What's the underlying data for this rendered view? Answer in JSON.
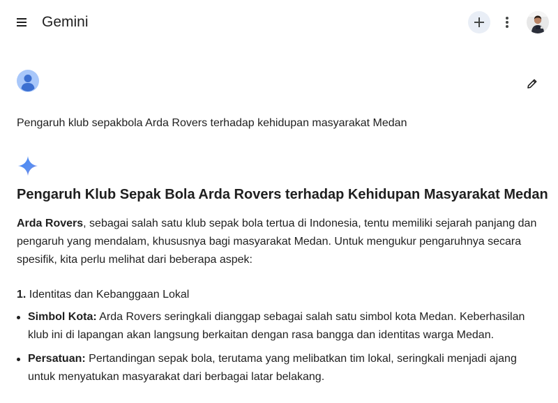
{
  "header": {
    "title": "Gemini",
    "menu_icon": "hamburger-menu-icon",
    "new_chat_icon": "plus-icon",
    "more_icon": "more-vert-icon"
  },
  "user_message": {
    "text": "Pengaruh klub sepakbola Arda Rovers terhadap kehidupan masyarakat Medan"
  },
  "response": {
    "heading": "Pengaruh Klub Sepak Bola Arda Rovers terhadap Kehidupan Masyarakat Medan",
    "intro_bold": "Arda Rovers",
    "intro_rest": ", sebagai salah satu klub sepak bola tertua di Indonesia, tentu memiliki sejarah panjang dan pengaruh yang mendalam, khususnya bagi masyarakat Medan. Untuk mengukur pengaruhnya secara spesifik, kita perlu melihat dari beberapa aspek:",
    "sections": [
      {
        "number": "1.",
        "title": "Identitas dan Kebanggaan Lokal",
        "bullets": [
          {
            "label": "Simbol Kota:",
            "text": " Arda Rovers seringkali dianggap sebagai salah satu simbol kota Medan. Keberhasilan klub ini di lapangan akan langsung berkaitan dengan rasa bangga dan identitas warga Medan."
          },
          {
            "label": "Persatuan:",
            "text": " Pertandingan sepak bola, terutama yang melibatkan tim lokal, seringkali menjadi ajang untuk menyatukan masyarakat dari berbagai latar belakang."
          }
        ]
      }
    ]
  },
  "colors": {
    "text": "#1f1f1f",
    "new_chat_bg": "#e9eef6",
    "user_avatar_bg": "#a8c7fa",
    "user_avatar_fg": "#3b6fd1",
    "spark_blue": "#4285f4",
    "spark_purple": "#9b72cb"
  }
}
